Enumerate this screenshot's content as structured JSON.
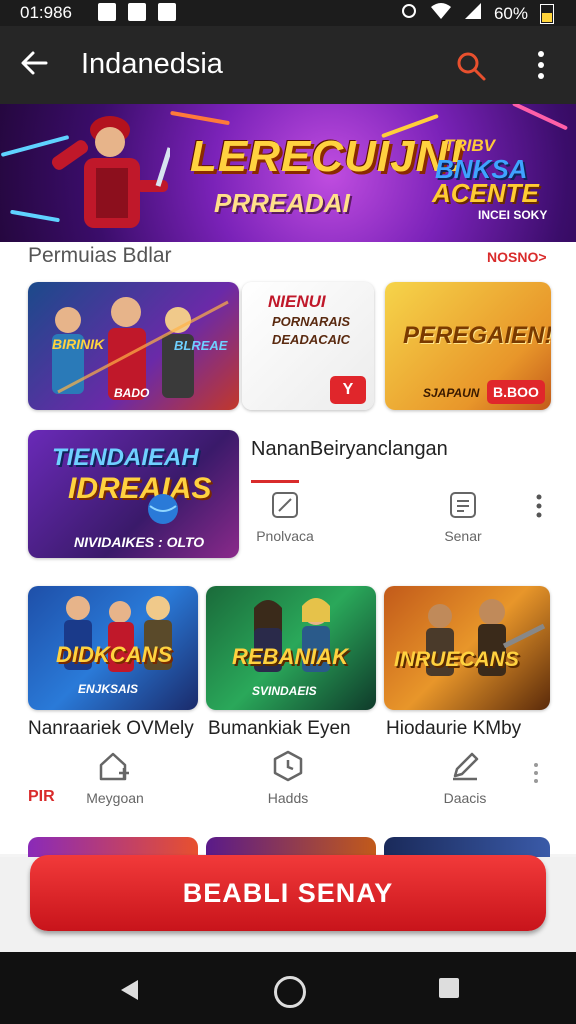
{
  "status_bar": {
    "time": "01:986",
    "battery": "60%"
  },
  "app_bar": {
    "title": "Indanedsia"
  },
  "banner": {
    "title": "LERECUIJN!",
    "subtitle": "PRREADAI",
    "right_line1": "TRIBV",
    "right_line2": "BNKSA",
    "right_line3": "ACENTE",
    "right_small": "INCEI SOKY"
  },
  "section": {
    "title": "Permuias Bdlar",
    "link": "NOSNO>"
  },
  "featured": [
    {
      "text": "BIRINIK",
      "sub": "BLREAE",
      "foot": "BADO"
    },
    {
      "text": "NIENUI",
      "sub": "PORNARAIS",
      "sub2": "DEADACAIC",
      "badge": "Y"
    },
    {
      "text": "PEREGAIEN!",
      "foot": "SJAPAUN",
      "badge": "B.BOO"
    }
  ],
  "promo": {
    "line1": "TIENDAIEAH",
    "line2": "IDREAIAS",
    "foot": "NIVIDAIKES : OLTO",
    "title": "NananBeiryanclangan",
    "actions": [
      {
        "label": "Pnolvaca"
      },
      {
        "label": "Senar"
      }
    ]
  },
  "games": [
    {
      "art": "DIDKCANS",
      "art_sub": "ENJKSAIS",
      "label": "Nanraariek OVMely"
    },
    {
      "art": "REBANIAK",
      "art_sub": "SVINDAEIS",
      "label": "Bumankiak Eyen"
    },
    {
      "art": "INRUECANS",
      "art_sub": "",
      "label": "Hiodaurie KMby"
    }
  ],
  "tools": {
    "left_tag": "PIR",
    "items": [
      {
        "label": "Meygoan"
      },
      {
        "label": "Hadds"
      },
      {
        "label": "Daacis"
      }
    ]
  },
  "cta": {
    "label": "BEABLI SENAY"
  }
}
